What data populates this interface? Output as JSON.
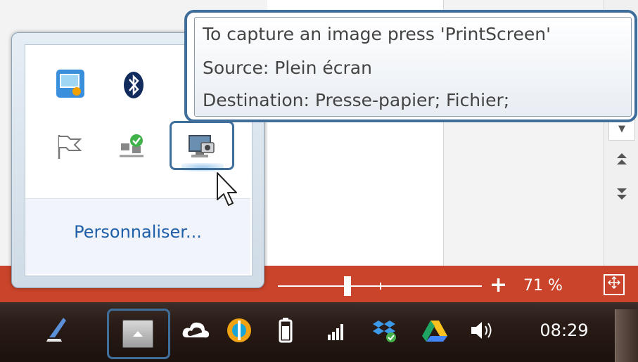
{
  "tooltip": {
    "line1": "To capture an image press 'PrintScreen'",
    "line2": "Source:  Plein écran",
    "line3": "Destination:  Presse-papier; Fichier;"
  },
  "tray_popup": {
    "customize_label": "Personnaliser...",
    "icons": [
      "network-share-icon",
      "bluetooth-icon",
      "flag-icon",
      "network-sync-icon",
      "screen-capture-icon"
    ]
  },
  "status_bar": {
    "zoom_level": "71 %",
    "zoom_plus": "+",
    "zoom_fraction": 0.34
  },
  "taskbar": {
    "clock": "08:29",
    "tray_icons": [
      "cloud-icon",
      "app-ring-icon",
      "battery-icon",
      "signal-icon",
      "dropbox-icon",
      "google-drive-icon",
      "volume-icon"
    ]
  },
  "colors": {
    "accent": "#3f6e9a",
    "statusbar": "#c9442a",
    "link": "#1f5fa8"
  }
}
